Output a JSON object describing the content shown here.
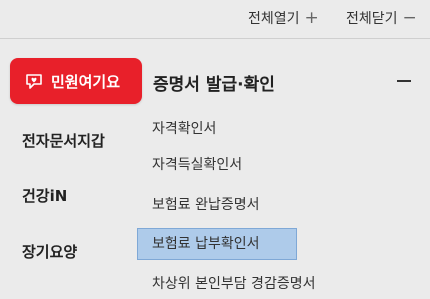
{
  "header": {
    "expand_all": "전체열기",
    "collapse_all": "전체닫기"
  },
  "sidebar": {
    "active": "민원여기요",
    "items": [
      "전자문서지갑",
      "건강iN",
      "장기요양"
    ]
  },
  "panel": {
    "title": "증명서 발급·확인",
    "items": [
      "자격확인서",
      "자격득실확인서",
      "보험료 완납증명서",
      "보험료 납부확인서",
      "차상위 본인부담 경감증명서"
    ],
    "selected_index": 3
  },
  "colors": {
    "active_bg": "#e8202a",
    "highlight_bg": "#aecbea"
  }
}
